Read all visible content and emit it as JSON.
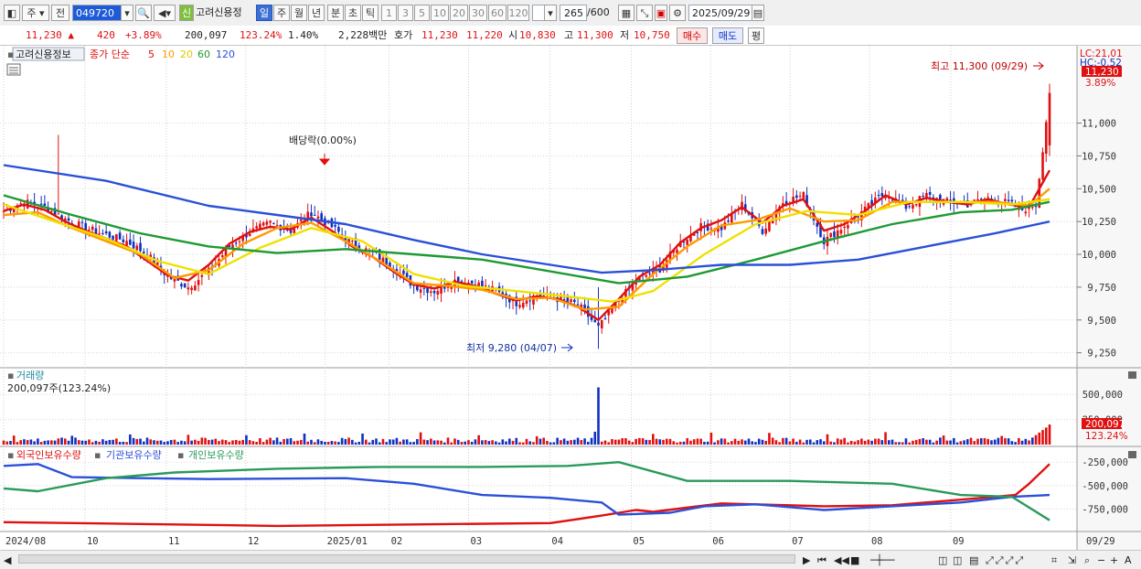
{
  "toolbar": {
    "market": "주",
    "prev_label": "전",
    "code": "049720",
    "credit_badge": "신",
    "stock_name": "고려신용정",
    "period_buttons": [
      "일",
      "주",
      "월",
      "년",
      "분",
      "초",
      "틱"
    ],
    "interval_buttons": [
      "1",
      "3",
      "5",
      "10",
      "20",
      "30",
      "60",
      "120"
    ],
    "count": "265",
    "count_max": "/600",
    "date": "2025/09/29"
  },
  "quote": {
    "price": "11,230",
    "change": "420",
    "change_pct": "+3.89%",
    "volume": "200,097",
    "volume_ratio": "123.24%",
    "turnover": "1.40%",
    "amount": "2,228백만",
    "bid_label": "호가",
    "ask_price": "11,230",
    "bid_price": "11,220",
    "open_label": "시",
    "open": "10,830",
    "high_label": "고",
    "high": "11,300",
    "low_label": "저",
    "low": "10,750",
    "buy_button": "매수",
    "sell_button": "매도",
    "eval_button": "평"
  },
  "price_panel": {
    "info_tab": "고려신용정보",
    "ma_legend_prefix": "종가 단순",
    "ma_periods": [
      "5",
      "10",
      "20",
      "60",
      "120"
    ],
    "ma_colors": [
      "#e01010",
      "#ff9a00",
      "#f0e000",
      "#1e9a32",
      "#2a50d8"
    ],
    "dividend_note": "배당락(0.00%)",
    "high_note": "최고 11,300 (09/29)",
    "low_note": "최저 9,280 (04/07)",
    "lc_label": "LC:21,01",
    "hc_label": "HC:-0.52",
    "price_tag": "11,230",
    "pct_tag": "3.89%"
  },
  "volume_panel": {
    "title": "거래량",
    "summary": "200,097주(123.24%)",
    "tag": "200,097",
    "pct_tag": "123.24%"
  },
  "holdings_panel": {
    "legends": [
      "외국인보유수량",
      "기관보유수량",
      "개인보유수량"
    ],
    "colors": [
      "#e01010",
      "#2a50d8",
      "#2a9a5a"
    ]
  },
  "x_axis": {
    "labels": [
      "2024/08",
      "10",
      "11",
      "12",
      "2025/01",
      "02",
      "03",
      "04",
      "05",
      "06",
      "07",
      "08",
      "09"
    ],
    "last_label": "09/29"
  },
  "chart_data": [
    {
      "type": "candlestick",
      "title": "고려신용정보 일봉",
      "y_ticks": [
        9250,
        9500,
        9750,
        10000,
        10250,
        10500,
        10750,
        11000
      ],
      "y_tick_labels": [
        "9,250",
        "9,500",
        "9,750",
        "10,000",
        "10,250",
        "10,500",
        "10,750",
        "11,000"
      ],
      "ylim": [
        9150,
        11450
      ],
      "close_path_points": [
        [
          0,
          10330
        ],
        [
          6,
          10400
        ],
        [
          12,
          10360
        ],
        [
          18,
          10270
        ],
        [
          24,
          10200
        ],
        [
          30,
          10150
        ],
        [
          36,
          10100
        ],
        [
          42,
          10000
        ],
        [
          48,
          9830
        ],
        [
          54,
          9750
        ],
        [
          60,
          9870
        ],
        [
          66,
          10060
        ],
        [
          72,
          10170
        ],
        [
          78,
          10240
        ],
        [
          84,
          10180
        ],
        [
          90,
          10320
        ],
        [
          96,
          10210
        ],
        [
          102,
          10080
        ],
        [
          108,
          10010
        ],
        [
          114,
          9900
        ],
        [
          120,
          9760
        ],
        [
          126,
          9720
        ],
        [
          132,
          9800
        ],
        [
          138,
          9780
        ],
        [
          144,
          9720
        ],
        [
          150,
          9630
        ],
        [
          156,
          9690
        ],
        [
          162,
          9660
        ],
        [
          168,
          9620
        ],
        [
          174,
          9440
        ],
        [
          180,
          9650
        ],
        [
          186,
          9820
        ],
        [
          192,
          9890
        ],
        [
          198,
          10090
        ],
        [
          204,
          10210
        ],
        [
          210,
          10200
        ],
        [
          216,
          10380
        ],
        [
          222,
          10180
        ],
        [
          228,
          10400
        ],
        [
          234,
          10450
        ],
        [
          240,
          10100
        ],
        [
          246,
          10220
        ],
        [
          252,
          10340
        ],
        [
          258,
          10470
        ],
        [
          264,
          10360
        ],
        [
          270,
          10450
        ],
        [
          276,
          10400
        ],
        [
          282,
          10380
        ],
        [
          288,
          10430
        ],
        [
          294,
          10390
        ],
        [
          298,
          10340
        ],
        [
          302,
          10380
        ],
        [
          306,
          11230
        ]
      ],
      "x_count": 307,
      "ma_series": [
        {
          "name": "5",
          "points": [
            [
              0,
              10330
            ],
            [
              6,
              10380
            ],
            [
              12,
              10340
            ],
            [
              18,
              10250
            ],
            [
              24,
              10180
            ],
            [
              30,
              10120
            ],
            [
              36,
              10060
            ],
            [
              42,
              9950
            ],
            [
              48,
              9840
            ],
            [
              54,
              9800
            ],
            [
              60,
              9920
            ],
            [
              66,
              10080
            ],
            [
              72,
              10170
            ],
            [
              78,
              10210
            ],
            [
              84,
              10190
            ],
            [
              90,
              10280
            ],
            [
              96,
              10180
            ],
            [
              102,
              10060
            ],
            [
              108,
              9980
            ],
            [
              114,
              9870
            ],
            [
              120,
              9770
            ],
            [
              126,
              9740
            ],
            [
              132,
              9790
            ],
            [
              138,
              9760
            ],
            [
              144,
              9700
            ],
            [
              150,
              9650
            ],
            [
              156,
              9680
            ],
            [
              162,
              9660
            ],
            [
              168,
              9600
            ],
            [
              174,
              9500
            ],
            [
              180,
              9660
            ],
            [
              186,
              9830
            ],
            [
              192,
              9920
            ],
            [
              198,
              10090
            ],
            [
              204,
              10200
            ],
            [
              210,
              10260
            ],
            [
              216,
              10360
            ],
            [
              222,
              10240
            ],
            [
              228,
              10370
            ],
            [
              234,
              10420
            ],
            [
              240,
              10180
            ],
            [
              246,
              10230
            ],
            [
              252,
              10330
            ],
            [
              258,
              10450
            ],
            [
              264,
              10380
            ],
            [
              270,
              10430
            ],
            [
              276,
              10400
            ],
            [
              282,
              10380
            ],
            [
              288,
              10420
            ],
            [
              294,
              10380
            ],
            [
              300,
              10360
            ],
            [
              306,
              10640
            ]
          ]
        },
        {
          "name": "10",
          "points": [
            [
              0,
              10300
            ],
            [
              10,
              10320
            ],
            [
              20,
              10200
            ],
            [
              30,
              10100
            ],
            [
              40,
              10000
            ],
            [
              50,
              9820
            ],
            [
              60,
              9880
            ],
            [
              70,
              10080
            ],
            [
              80,
              10200
            ],
            [
              90,
              10240
            ],
            [
              100,
              10100
            ],
            [
              110,
              9950
            ],
            [
              120,
              9780
            ],
            [
              130,
              9760
            ],
            [
              140,
              9730
            ],
            [
              150,
              9660
            ],
            [
              160,
              9670
            ],
            [
              170,
              9580
            ],
            [
              180,
              9600
            ],
            [
              190,
              9850
            ],
            [
              200,
              10060
            ],
            [
              210,
              10220
            ],
            [
              220,
              10260
            ],
            [
              230,
              10350
            ],
            [
              240,
              10250
            ],
            [
              250,
              10260
            ],
            [
              260,
              10400
            ],
            [
              270,
              10400
            ],
            [
              280,
              10400
            ],
            [
              290,
              10400
            ],
            [
              300,
              10370
            ],
            [
              306,
              10500
            ]
          ]
        },
        {
          "name": "20",
          "points": [
            [
              0,
              10380
            ],
            [
              15,
              10250
            ],
            [
              30,
              10120
            ],
            [
              45,
              9950
            ],
            [
              60,
              9850
            ],
            [
              75,
              10050
            ],
            [
              90,
              10200
            ],
            [
              105,
              10100
            ],
            [
              120,
              9850
            ],
            [
              135,
              9760
            ],
            [
              150,
              9720
            ],
            [
              165,
              9680
            ],
            [
              178,
              9640
            ],
            [
              190,
              9720
            ],
            [
              205,
              10000
            ],
            [
              220,
              10230
            ],
            [
              235,
              10330
            ],
            [
              250,
              10300
            ],
            [
              265,
              10400
            ],
            [
              280,
              10400
            ],
            [
              295,
              10380
            ],
            [
              306,
              10420
            ]
          ]
        },
        {
          "name": "60",
          "points": [
            [
              0,
              10450
            ],
            [
              20,
              10300
            ],
            [
              40,
              10160
            ],
            [
              60,
              10060
            ],
            [
              80,
              10010
            ],
            [
              100,
              10040
            ],
            [
              120,
              10000
            ],
            [
              140,
              9960
            ],
            [
              160,
              9870
            ],
            [
              180,
              9780
            ],
            [
              200,
              9830
            ],
            [
              220,
              9960
            ],
            [
              240,
              10100
            ],
            [
              260,
              10230
            ],
            [
              280,
              10320
            ],
            [
              295,
              10340
            ],
            [
              306,
              10400
            ]
          ]
        },
        {
          "name": "120",
          "points": [
            [
              0,
              10680
            ],
            [
              30,
              10560
            ],
            [
              60,
              10370
            ],
            [
              80,
              10300
            ],
            [
              100,
              10230
            ],
            [
              120,
              10110
            ],
            [
              140,
              10000
            ],
            [
              160,
              9920
            ],
            [
              175,
              9860
            ],
            [
              190,
              9880
            ],
            [
              210,
              9920
            ],
            [
              230,
              9920
            ],
            [
              250,
              9960
            ],
            [
              270,
              10060
            ],
            [
              290,
              10160
            ],
            [
              306,
              10250
            ]
          ]
        }
      ]
    },
    {
      "type": "bar",
      "title": "거래량",
      "y_ticks": [
        500000,
        250000
      ],
      "y_tick_labels": [
        "500,000",
        "250,000"
      ],
      "ylim": [
        0,
        620000
      ],
      "spike_index": 174,
      "spike_value": 570000,
      "last_value": 200097
    },
    {
      "type": "line",
      "title": "보유수량",
      "y_ticks": [
        -250000,
        -500000,
        -750000
      ],
      "y_tick_labels": [
        "-250,000",
        "-500,000",
        "-750,000"
      ],
      "ylim": [
        -980000,
        -150000
      ],
      "series": [
        {
          "name": "외국인보유수량",
          "color": "#e01010",
          "points": [
            [
              0,
              -890000
            ],
            [
              40,
              -910000
            ],
            [
              80,
              -930000
            ],
            [
              120,
              -915000
            ],
            [
              160,
              -900000
            ],
            [
              175,
              -820000
            ],
            [
              185,
              -760000
            ],
            [
              190,
              -780000
            ],
            [
              210,
              -690000
            ],
            [
              220,
              -700000
            ],
            [
              240,
              -720000
            ],
            [
              260,
              -710000
            ],
            [
              280,
              -650000
            ],
            [
              296,
              -600000
            ],
            [
              300,
              -480000
            ],
            [
              306,
              -270000
            ]
          ]
        },
        {
          "name": "기관보유수량",
          "color": "#2a50d8",
          "points": [
            [
              0,
              -290000
            ],
            [
              10,
              -270000
            ],
            [
              20,
              -410000
            ],
            [
              60,
              -430000
            ],
            [
              100,
              -420000
            ],
            [
              120,
              -480000
            ],
            [
              140,
              -600000
            ],
            [
              160,
              -630000
            ],
            [
              175,
              -680000
            ],
            [
              180,
              -810000
            ],
            [
              195,
              -790000
            ],
            [
              205,
              -720000
            ],
            [
              220,
              -700000
            ],
            [
              240,
              -760000
            ],
            [
              260,
              -720000
            ],
            [
              280,
              -680000
            ],
            [
              295,
              -620000
            ],
            [
              306,
              -600000
            ]
          ]
        },
        {
          "name": "개인보유수량",
          "color": "#2a9a5a",
          "points": [
            [
              0,
              -530000
            ],
            [
              10,
              -560000
            ],
            [
              30,
              -420000
            ],
            [
              50,
              -360000
            ],
            [
              80,
              -320000
            ],
            [
              110,
              -300000
            ],
            [
              140,
              -300000
            ],
            [
              165,
              -290000
            ],
            [
              180,
              -250000
            ],
            [
              200,
              -450000
            ],
            [
              230,
              -450000
            ],
            [
              260,
              -480000
            ],
            [
              280,
              -600000
            ],
            [
              295,
              -620000
            ],
            [
              306,
              -870000
            ]
          ]
        }
      ]
    }
  ]
}
